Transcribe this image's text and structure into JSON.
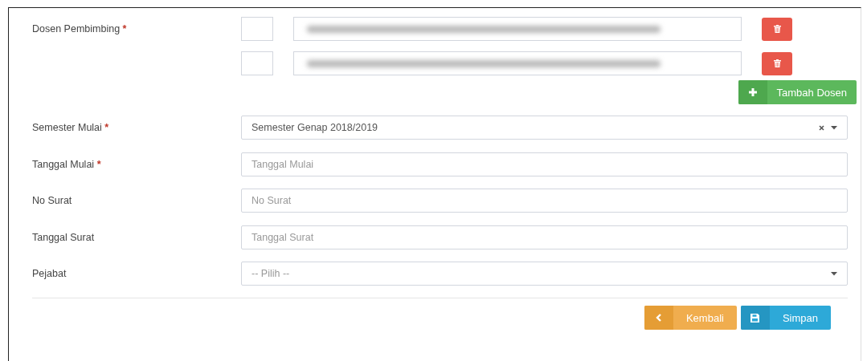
{
  "lecturers": {
    "label": "Dosen Pembimbing",
    "required_mark": "*",
    "rows": [
      {
        "blurred": true
      },
      {
        "blurred": true
      }
    ],
    "add_button": "Tambah Dosen"
  },
  "fields": [
    {
      "label": "Semester Mulai",
      "required_mark": "*",
      "kind": "select",
      "value": "Semester Genap 2018/2019",
      "clearable": true
    },
    {
      "label": "Tanggal Mulai",
      "required_mark": "*",
      "kind": "text",
      "placeholder": "Tanggal Mulai"
    },
    {
      "label": "No Surat",
      "kind": "text",
      "placeholder": "No Surat"
    },
    {
      "label": "Tanggal Surat",
      "kind": "text",
      "placeholder": "Tanggal Surat"
    },
    {
      "label": "Pejabat",
      "kind": "select",
      "placeholder": "-- Pilih --",
      "clearable": false
    }
  ],
  "actions": [
    {
      "label": "Kembali",
      "kind": "back"
    },
    {
      "label": "Simpan",
      "kind": "save"
    }
  ]
}
